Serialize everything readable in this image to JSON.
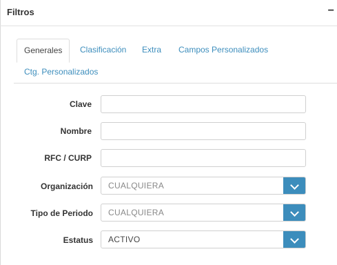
{
  "panel": {
    "title": "Filtros",
    "collapse_symbol": "−"
  },
  "tabs": [
    {
      "label": "Generales",
      "active": true
    },
    {
      "label": "Clasificación",
      "active": false
    },
    {
      "label": "Extra",
      "active": false
    },
    {
      "label": "Campos Personalizados",
      "active": false
    },
    {
      "label": "Ctg. Personalizados",
      "active": false
    }
  ],
  "fields": {
    "clave": {
      "label": "Clave",
      "value": ""
    },
    "nombre": {
      "label": "Nombre",
      "value": ""
    },
    "rfc": {
      "label": "RFC / CURP",
      "value": ""
    },
    "organizacion": {
      "label": "Organización",
      "selected": "CUALQUIERA"
    },
    "tipo_periodo": {
      "label": "Tipo de Periodo",
      "selected": "CUALQUIERA"
    },
    "estatus": {
      "label": "Estatus",
      "selected": "ACTIVO"
    }
  },
  "colors": {
    "accent": "#3c8dbc",
    "border": "#cfcfcf"
  },
  "icons": {
    "collapse": "minus-icon",
    "dropdown": "chevron-down-icon"
  }
}
